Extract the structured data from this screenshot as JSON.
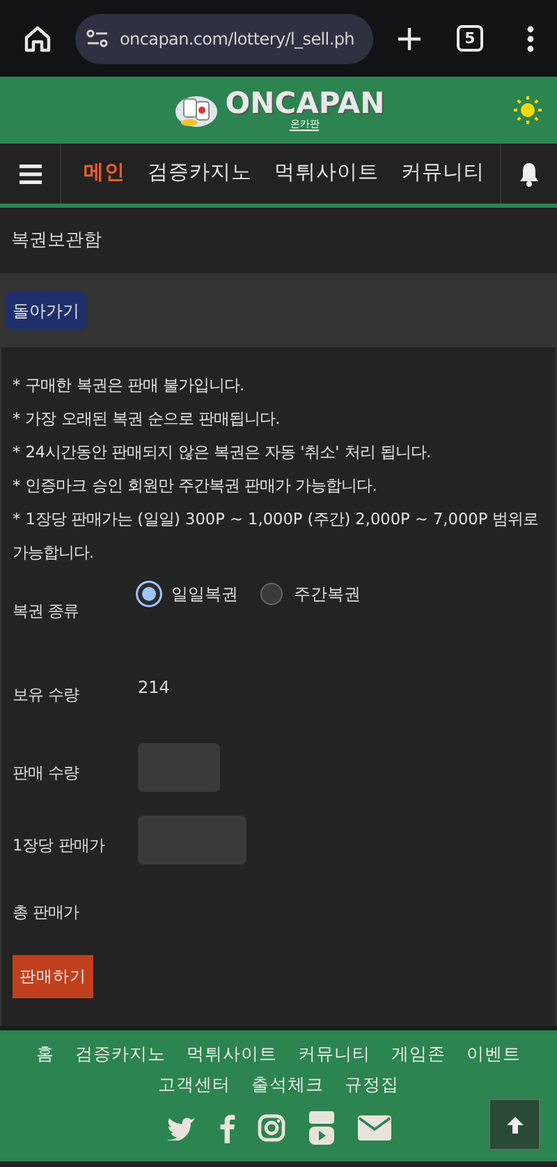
{
  "browser": {
    "url": "oncapan.com/lottery/l_sell.ph",
    "tab_count": "5"
  },
  "header": {
    "logo": "ONCAPAN",
    "logo_sub": "온카판"
  },
  "nav": [
    {
      "label": "메인",
      "selected": true
    },
    {
      "label": "검증카지노",
      "selected": false
    },
    {
      "label": "먹튀사이트",
      "selected": false
    },
    {
      "label": "커뮤니티",
      "selected": false
    }
  ],
  "page_title": "복권보관함",
  "back_button": "돌아가기",
  "notes": [
    "* 구매한 복권은 판매 불가입니다.",
    "* 가장 오래된 복권 순으로 판매됩니다.",
    "* 24시간동안 판매되지 않은 복권은 자동 '취소' 처리 됩니다.",
    "* 인증마크 승인 회원만 주간복권 판매가 가능합니다.",
    "* 1장당 판매가는 (일일) 300P ~ 1,000P (주간) 2,000P ~ 7,000P 범위로 가능합니다."
  ],
  "form": [
    {
      "kind": "radio",
      "label": "복권 종류",
      "options": [
        {
          "label": "일일복권",
          "selected": true
        },
        {
          "label": "주간복권",
          "selected": false
        }
      ]
    },
    {
      "kind": "text",
      "label": "보유 수량",
      "value": "214"
    },
    {
      "kind": "input",
      "label": "판매 수량"
    },
    {
      "kind": "wideinput",
      "label": "1장당 판매가"
    },
    {
      "kind": "empty",
      "label": "총 판매가"
    }
  ],
  "submit_button": "판매하기",
  "footer": {
    "links": [
      "홈",
      "검증카지노",
      "먹튀사이트",
      "커뮤니티",
      "게임존",
      "이벤트",
      "고객센터",
      "출석체크",
      "규정집"
    ]
  }
}
